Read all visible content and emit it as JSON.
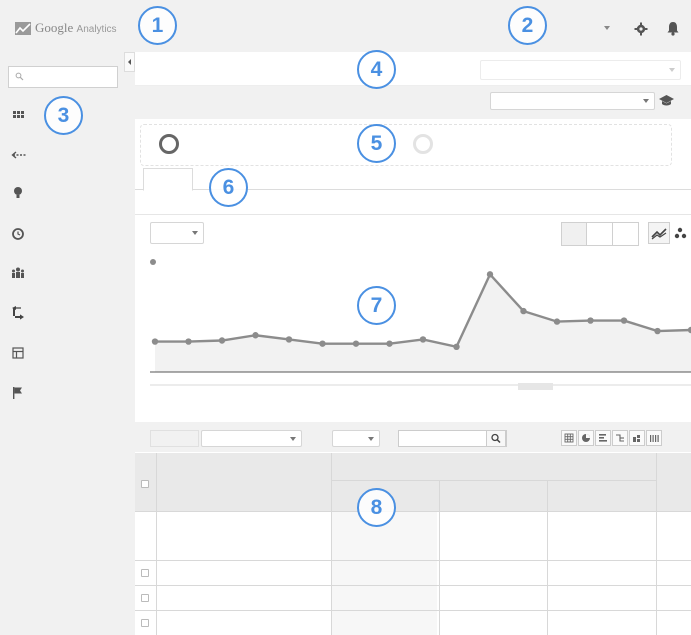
{
  "app": {
    "logo_text": "Google",
    "logo_subtext": "Analytics"
  },
  "callouts": [
    "1",
    "2",
    "3",
    "4",
    "5",
    "6",
    "7",
    "8"
  ],
  "icons": {
    "logo": "analytics-logo-icon",
    "account_caret": "chevron-down-icon",
    "settings": "gear-icon",
    "notifications": "bell-icon",
    "search": "search-icon",
    "collapse": "chevron-left-icon",
    "nav": [
      "dashboard-grid-icon",
      "arrow-left-icon",
      "bulb-icon",
      "clock-icon",
      "audience-icon",
      "acquisition-arrows-icon",
      "behavior-table-icon",
      "flag-icon"
    ],
    "education": "graduation-cap-icon",
    "chart_line": "line-chart-icon",
    "chart_motion": "motion-chart-icon",
    "table_search": "search-icon",
    "views": [
      "grid-view-icon",
      "pie-view-icon",
      "bar-view-icon",
      "compare-view-icon",
      "pivot-view-icon",
      "term-cloud-view-icon"
    ]
  },
  "chart_data": {
    "type": "line",
    "series": [
      {
        "values": [
          0.29,
          0.29,
          0.3,
          0.35,
          0.31,
          0.27,
          0.27,
          0.27,
          0.31,
          0.24,
          0.93,
          0.58,
          0.48,
          0.49,
          0.49,
          0.39,
          0.4
        ]
      }
    ],
    "ylim": [
      0,
      1
    ],
    "grid": false,
    "color": "#8c8c8c"
  },
  "colors": {
    "callout": "#4a90e2",
    "line": "#8c8c8c",
    "background": "#f1f1f1"
  }
}
